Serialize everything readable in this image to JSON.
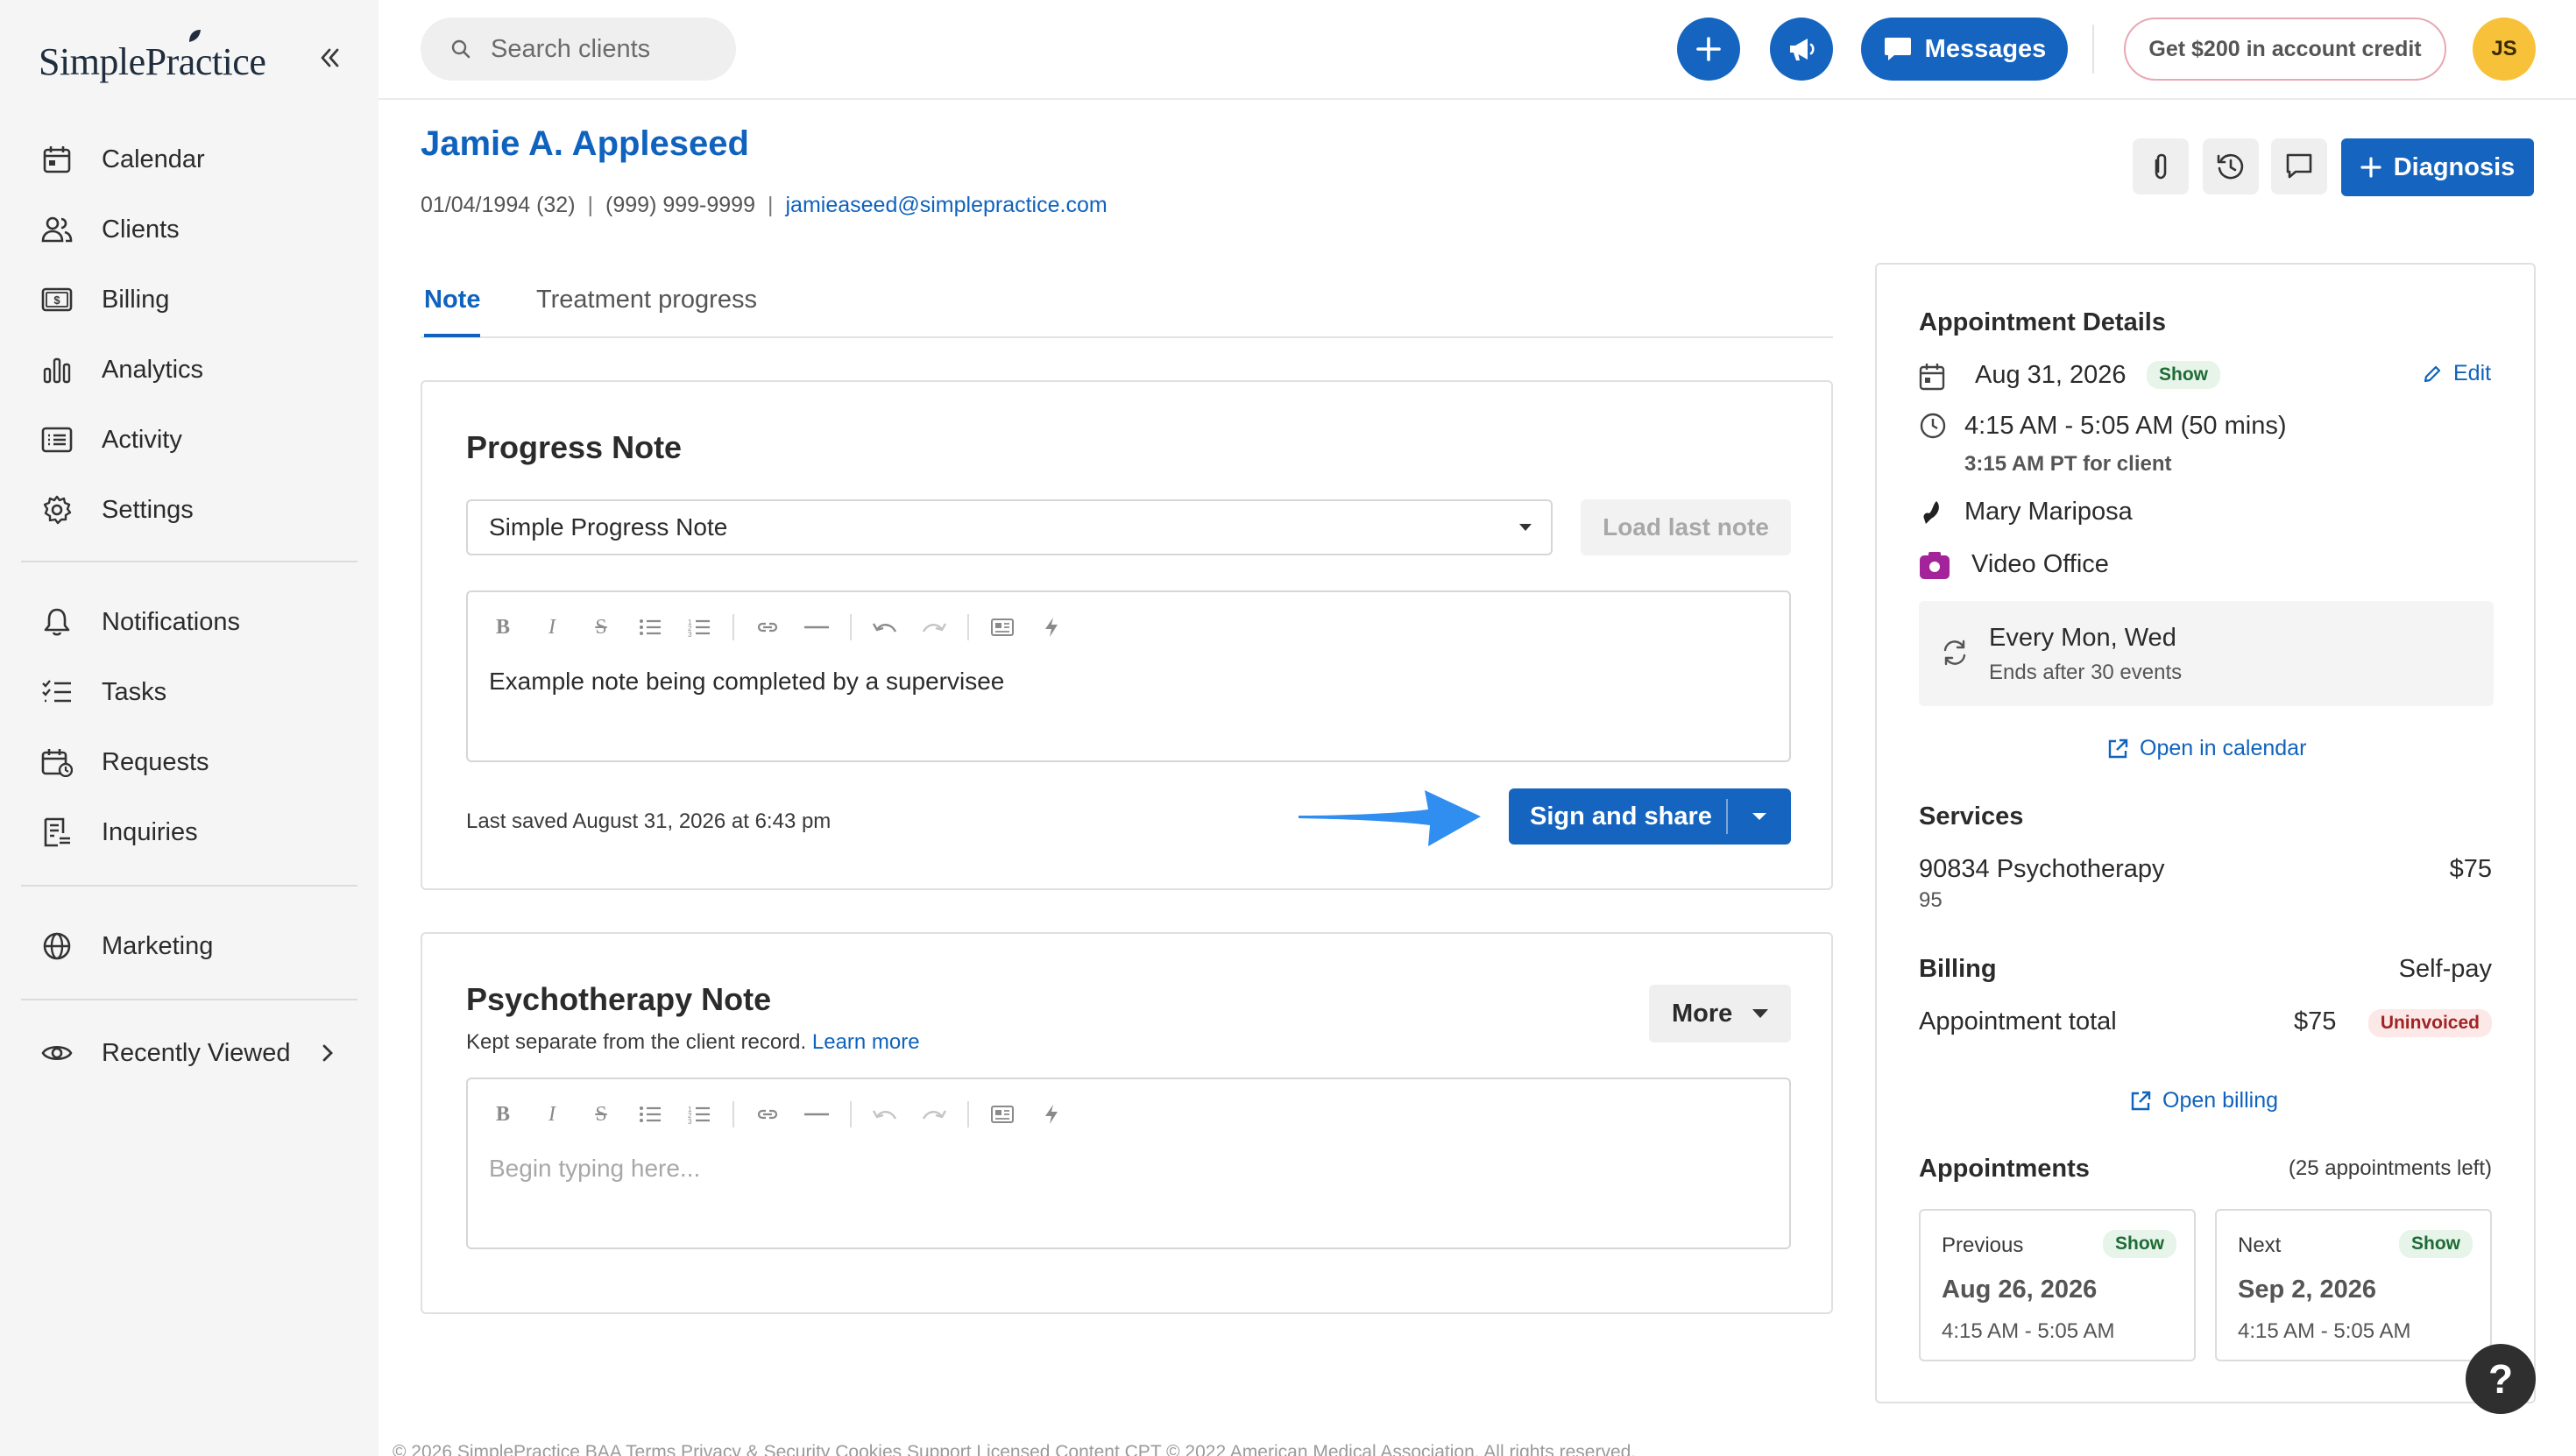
{
  "brand": {
    "name": "SimplePractice"
  },
  "sidebar": {
    "items": [
      {
        "label": "Calendar",
        "icon": "calendar-icon"
      },
      {
        "label": "Clients",
        "icon": "clients-icon"
      },
      {
        "label": "Billing",
        "icon": "billing-icon"
      },
      {
        "label": "Analytics",
        "icon": "analytics-icon"
      },
      {
        "label": "Activity",
        "icon": "activity-icon"
      },
      {
        "label": "Settings",
        "icon": "gear-icon"
      },
      {
        "label": "Notifications",
        "icon": "bell-icon"
      },
      {
        "label": "Tasks",
        "icon": "tasks-icon"
      },
      {
        "label": "Requests",
        "icon": "requests-icon"
      },
      {
        "label": "Inquiries",
        "icon": "inquiries-icon"
      },
      {
        "label": "Marketing",
        "icon": "globe-icon"
      },
      {
        "label": "Recently Viewed",
        "icon": "eye-icon"
      }
    ]
  },
  "topbar": {
    "search_placeholder": "Search clients",
    "messages_label": "Messages",
    "credit_label": "Get $200 in account credit",
    "avatar_initials": "JS"
  },
  "client": {
    "name": "Jamie A. Appleseed",
    "dob": "01/04/1994 (32)",
    "phone": "(999) 999-9999",
    "email": "jamieaseed@simplepractice.com",
    "diagnosis_label": "Diagnosis"
  },
  "tabs": [
    {
      "label": "Note",
      "active": true
    },
    {
      "label": "Treatment progress",
      "active": false
    }
  ],
  "progress_note": {
    "title": "Progress Note",
    "template": "Simple Progress Note",
    "load_last_label": "Load last note",
    "body": "Example note being completed by a supervisee",
    "last_saved": "Last saved August 31, 2026 at 6:43 pm",
    "sign_label": "Sign and share"
  },
  "psychotherapy_note": {
    "title": "Psychotherapy Note",
    "subtitle": "Kept separate from the client record.",
    "learn_more": "Learn more",
    "more_label": "More",
    "placeholder": "Begin typing here..."
  },
  "appointment": {
    "heading": "Appointment Details",
    "date": "Aug 31, 2026",
    "status": "Show",
    "edit_label": "Edit",
    "time": "4:15 AM - 5:05 AM (50 mins)",
    "client_time": "3:15 AM PT for client",
    "clinician": "Mary Mariposa",
    "location": "Video Office",
    "recurrence": "Every Mon, Wed",
    "recurrence_end": "Ends after 30 events",
    "open_calendar": "Open in calendar"
  },
  "services": {
    "heading": "Services",
    "items": [
      {
        "name": "90834 Psychotherapy",
        "duration": "95",
        "price": "$75"
      }
    ]
  },
  "billing": {
    "heading": "Billing",
    "type": "Self-pay",
    "total_label": "Appointment total",
    "total": "$75",
    "status": "Uninvoiced",
    "open_billing": "Open billing"
  },
  "appointments": {
    "heading": "Appointments",
    "remaining": "(25 appointments left)",
    "previous": {
      "label": "Previous",
      "status": "Show",
      "date": "Aug 26, 2026",
      "time": "4:15 AM - 5:05 AM"
    },
    "next": {
      "label": "Next",
      "status": "Show",
      "date": "Sep 2, 2026",
      "time": "4:15 AM - 5:05 AM"
    }
  },
  "help_label": "?",
  "footer_text": "© 2026 SimplePractice   BAA   Terms   Privacy & Security   Cookies   Support   Licensed Content   CPT © 2022 American Medical Association. All rights reserved.",
  "colors": {
    "primary": "#1565c0",
    "link": "#0f62bd",
    "avatar": "#f7c23a",
    "sidebar_bg": "#f5f5f5"
  }
}
